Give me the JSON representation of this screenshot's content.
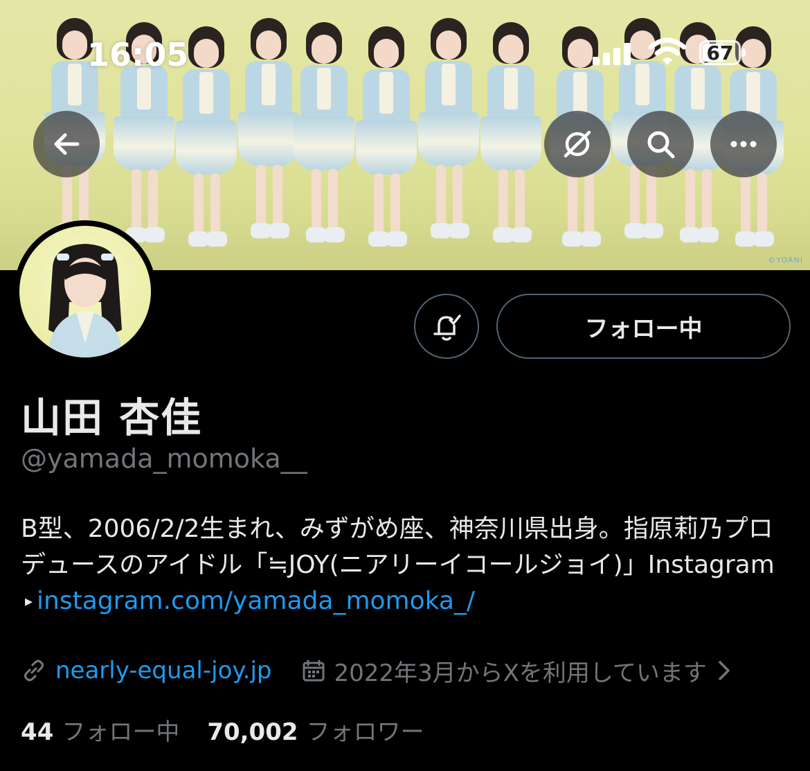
{
  "status_bar": {
    "time": "16:05",
    "battery": "67",
    "battery_level": 0.67
  },
  "banner": {
    "copyright": "©YOANI",
    "buttons": {
      "back": "back-arrow-icon",
      "grok": "grok-icon",
      "search": "search-icon",
      "more": "more-icon"
    }
  },
  "profile": {
    "display_name": "山田 杏佳",
    "handle": "@yamada_momoka__",
    "follow_button_label": "フォロー中",
    "notification_icon": "bell-check-icon",
    "bio": {
      "text_line": "B型、2006/2/2生まれ、みずがめ座、神奈川県出身。指原莉乃プロデュースのアイドル「≒JOY(ニアリーイコールジョイ)」Instagram",
      "arrow": "▸",
      "link": "instagram.com/yamada_momoka_/"
    },
    "website": "nearly-equal-joy.jp",
    "joined": "2022年3月からXを利用しています",
    "following_count": "44",
    "following_label": "フォロー中",
    "followers_count": "70,002",
    "followers_label": "フォロワー"
  },
  "colors": {
    "background": "#000000",
    "text": "#e7e9ea",
    "secondary": "#71767b",
    "link": "#1d9bf0",
    "border": "#536471"
  }
}
